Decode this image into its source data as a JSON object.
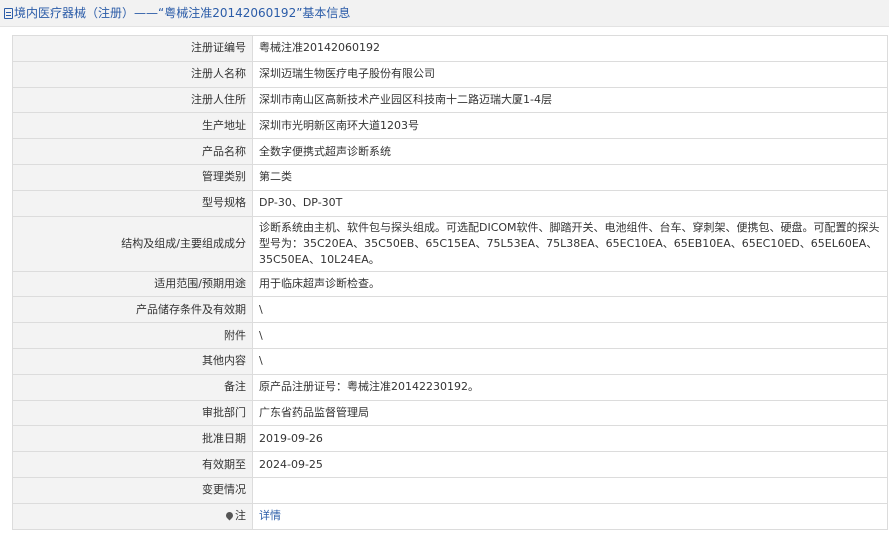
{
  "header": {
    "title": "境内医疗器械（注册）——“粤械注准20142060192”基本信息"
  },
  "rows": [
    {
      "label": "注册证编号",
      "value": "粤械注准20142060192"
    },
    {
      "label": "注册人名称",
      "value": "深圳迈瑞生物医疗电子股份有限公司"
    },
    {
      "label": "注册人住所",
      "value": "深圳市南山区高新技术产业园区科技南十二路迈瑞大厦1-4层"
    },
    {
      "label": "生产地址",
      "value": "深圳市光明新区南环大道1203号"
    },
    {
      "label": "产品名称",
      "value": "全数字便携式超声诊断系统"
    },
    {
      "label": "管理类别",
      "value": "第二类"
    },
    {
      "label": "型号规格",
      "value": "DP-30、DP-30T"
    },
    {
      "label": "结构及组成/主要组成成分",
      "value": "诊断系统由主机、软件包与探头组成。可选配DICOM软件、脚踏开关、电池组件、台车、穿刺架、便携包、硬盘。可配置的探头型号为：35C20EA、35C50EB、65C15EA、75L53EA、75L38EA、65EC10EA、65EB10EA、65EC10ED、65EL60EA、35C50EA、10L24EA。"
    },
    {
      "label": "适用范围/预期用途",
      "value": "用于临床超声诊断检查。"
    },
    {
      "label": "产品储存条件及有效期",
      "value": "\\"
    },
    {
      "label": "附件",
      "value": "\\"
    },
    {
      "label": "其他内容",
      "value": "\\"
    },
    {
      "label": "备注",
      "value": "原产品注册证号：粤械注准20142230192。"
    },
    {
      "label": "审批部门",
      "value": "广东省药品监督管理局"
    },
    {
      "label": "批准日期",
      "value": "2019-09-26"
    },
    {
      "label": "有效期至",
      "value": "2024-09-25"
    },
    {
      "label": "变更情况",
      "value": ""
    },
    {
      "label": "注",
      "value": "详情"
    }
  ],
  "icons": {
    "title_icon": "document-icon",
    "note_icon": "pin-icon"
  },
  "colors": {
    "link": "#2b5ca8",
    "label_bg": "#f3f3f3",
    "border": "#dcdcdc"
  }
}
